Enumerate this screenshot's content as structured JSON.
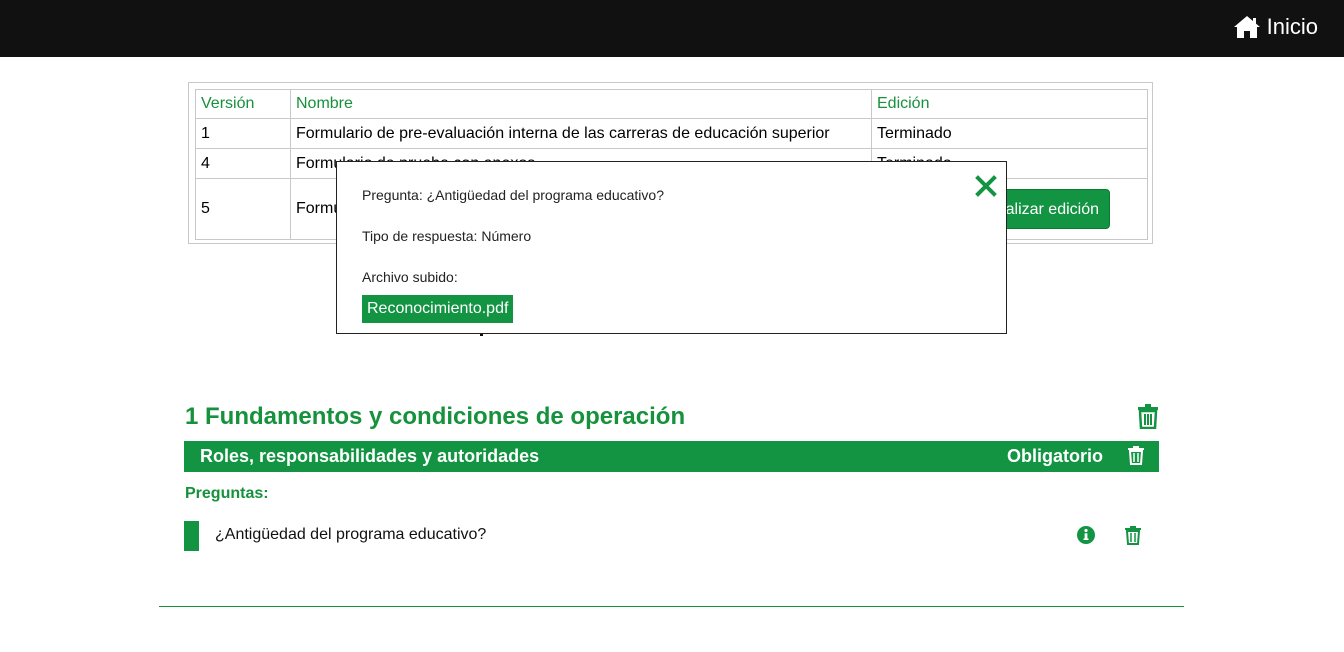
{
  "topbar": {
    "home_label": "Inicio",
    "home_icon": "home-icon"
  },
  "table": {
    "headers": [
      "Versión",
      "Nombre",
      "Edición"
    ],
    "rows": [
      {
        "version": "1",
        "name": "Formulario de pre-evaluación interna de las carreras de educación superior",
        "edition": "Terminado"
      },
      {
        "version": "4",
        "name": "Formulario de prueba con anexos",
        "edition": "Terminado"
      },
      {
        "version": "5",
        "name": "Formu",
        "edition": ""
      }
    ],
    "finish_button": "nalizar edición"
  },
  "modal": {
    "question": "Pregunta: ¿Antigüedad del programa educativo?",
    "answer_type": "Tipo de respuesta: Número",
    "file_label": "Archivo subido:",
    "file_name": "Reconocimiento.pdf"
  },
  "section": {
    "title": "1 Fundamentos y condiciones de operación",
    "subsection": "Roles, responsabilidades y autoridades",
    "required_label": "Obligatorio",
    "questions_label": "Preguntas:",
    "questions": [
      "¿Antigüedad del programa educativo?"
    ]
  },
  "colors": {
    "accent": "#129443",
    "topbar": "#111111"
  }
}
